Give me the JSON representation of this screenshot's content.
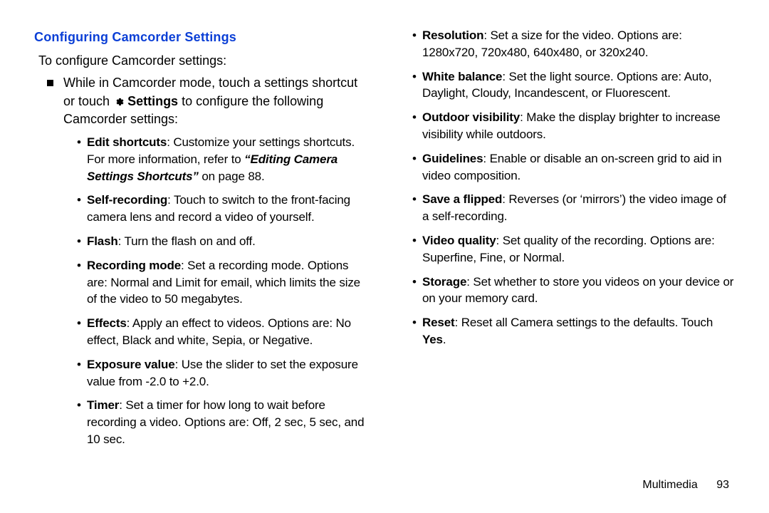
{
  "left": {
    "heading": "Configuring Camcorder Settings",
    "intro": "To configure Camcorder settings:",
    "instruction_pre": "While in Camcorder mode, touch a settings shortcut or touch ",
    "settings_label": "Settings",
    "instruction_post": " to configure the following Camcorder settings:",
    "items": [
      {
        "b": "Edit shortcuts",
        "t1": ": Customize your settings shortcuts. For more information, refer to ",
        "ref": "“Editing Camera Settings Shortcuts” ",
        "t2": " on page 88."
      },
      {
        "b": "Self-recording",
        "t1": ": Touch to switch to the front-facing camera lens and record a video of yourself."
      },
      {
        "b": "Flash",
        "t1": ": Turn the flash on and off."
      },
      {
        "b": "Recording mode",
        "t1": ": Set a recording mode. Options are: Normal and Limit for email, which limits the size of the video to 50 megabytes."
      },
      {
        "b": "Effects",
        "t1": ": Apply an effect to videos. Options are: No effect, Black and white, Sepia, or Negative."
      },
      {
        "b": "Exposure value",
        "t1": ": Use the slider to set the exposure value from -2.0 to +2.0."
      },
      {
        "b": "Timer",
        "t1": ": Set a timer for how long to wait before recording a video. Options are: Off, 2 sec, 5 sec, and 10 sec."
      }
    ]
  },
  "right": {
    "items": [
      {
        "b": "Resolution",
        "t1": ": Set a size for the video. Options are: 1280x720, 720x480, 640x480, or 320x240."
      },
      {
        "b": "White balance",
        "t1": ": Set the light source. Options are: Auto, Daylight, Cloudy, Incandescent, or Fluorescent."
      },
      {
        "b": "Outdoor visibility",
        "t1": ": Make the display brighter to increase visibility while outdoors."
      },
      {
        "b": "Guidelines",
        "t1": ": Enable or disable an on-screen grid to aid in video composition."
      },
      {
        "b": "Save a flipped",
        "t1": ": Reverses (or ‘mirrors’) the video image of a self-recording."
      },
      {
        "b": "Video quality",
        "t1": ": Set quality of the recording. Options are: Superfine, Fine, or Normal."
      },
      {
        "b": "Storage",
        "t1": ": Set whether to store you videos on your device or on your memory card."
      },
      {
        "b": "Reset",
        "t1": ": Reset all Camera settings to the defaults. Touch ",
        "b2": "Yes",
        "t2": "."
      }
    ]
  },
  "footer": {
    "section": "Multimedia",
    "page": "93"
  }
}
